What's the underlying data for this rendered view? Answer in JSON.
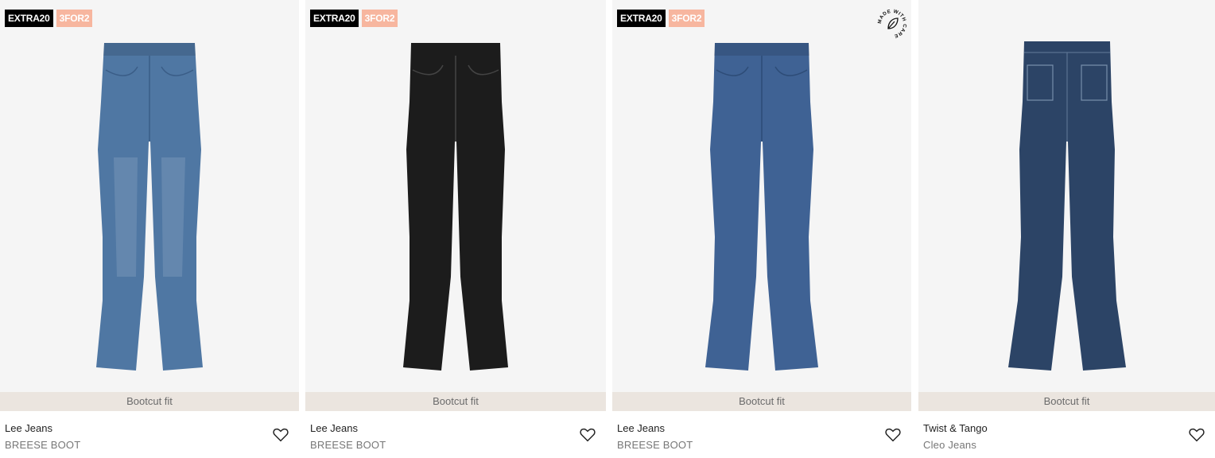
{
  "products": [
    {
      "badges": [
        "EXTRA20",
        "3FOR2"
      ],
      "fit": "Bootcut fit",
      "brand": "Lee Jeans",
      "model": "BREESE BOOT",
      "image": "medium-blue-bootcut-jeans",
      "denim_color": "#4f77a3",
      "has_care_seal": false
    },
    {
      "badges": [
        "EXTRA20",
        "3FOR2"
      ],
      "fit": "Bootcut fit",
      "brand": "Lee Jeans",
      "model": "BREESE BOOT",
      "image": "black-bootcut-jeans",
      "denim_color": "#1c1c1c",
      "has_care_seal": false
    },
    {
      "badges": [
        "EXTRA20",
        "3FOR2"
      ],
      "fit": "Bootcut fit",
      "brand": "Lee Jeans",
      "model": "BREESE BOOT",
      "image": "blue-bootcut-jeans",
      "denim_color": "#3f6294",
      "has_care_seal": true,
      "care_seal_text": "MADE WITH CARE"
    },
    {
      "badges": [],
      "fit": "Bootcut fit",
      "brand": "Twist & Tango",
      "model": "Cleo Jeans",
      "image": "dark-blue-flare-jeans-patch-pockets",
      "denim_color": "#2c4466",
      "has_care_seal": false
    }
  ],
  "icons": {
    "favorite": "heart-outline-icon"
  },
  "colors": {
    "badge_black": "#000000",
    "badge_peach": "#f7b69f",
    "fit_bar": "#ebe5df"
  }
}
